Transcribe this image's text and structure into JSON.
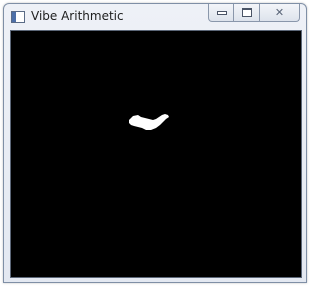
{
  "window": {
    "title": "Vibe Arithmetic",
    "icon": "app-window-icon",
    "buttons": {
      "minimize_icon": "minimize-icon",
      "maximize_icon": "maximize-icon",
      "close_icon": "close-icon",
      "close_glyph": "✕"
    }
  },
  "canvas": {
    "background_color": "#000000",
    "foreground_color": "#ffffff",
    "content": "foreground-blob"
  }
}
